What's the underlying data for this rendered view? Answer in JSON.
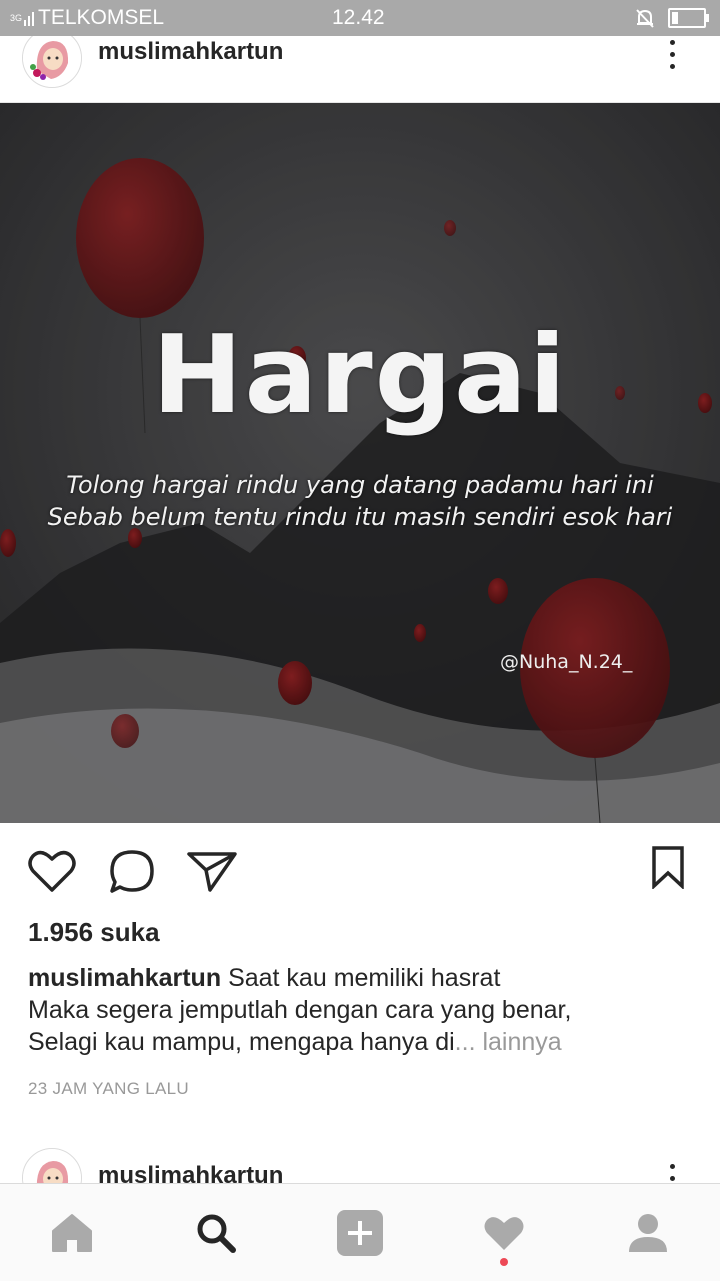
{
  "status_bar": {
    "network": "3G",
    "carrier": "TELKOMSEL",
    "time": "12.42"
  },
  "post": {
    "username": "muslimahkartun",
    "image": {
      "title": "Hargai",
      "quote_line1": "Tolong hargai rindu yang datang padamu hari ini",
      "quote_line2": "Sebab belum tentu rindu itu masih sendiri esok hari",
      "handle": "@Nuha_N.24_"
    },
    "likes": "1.956 suka",
    "caption": {
      "username": "muslimahkartun",
      "line1": "Saat kau memiliki hasrat",
      "line2": "Maka segera jemputlah dengan cara yang benar,",
      "line3": "Selagi kau mampu, mengapa hanya di",
      "more": "... lainnya"
    },
    "timestamp": "23 JAM YANG LALU"
  },
  "next_post": {
    "username": "muslimahkartun"
  },
  "icons": {
    "like": "heart-outline-icon",
    "comment": "comment-bubble-icon",
    "share": "paper-plane-icon",
    "save": "bookmark-icon",
    "more": "vertical-dots-icon"
  },
  "bottom_nav": [
    "home-icon",
    "search-icon",
    "add-post-icon",
    "activity-heart-icon",
    "profile-icon"
  ],
  "colors": {
    "status_bar": "#a9a9a9",
    "text": "#262626",
    "muted": "#999999",
    "notification": "#ed4956",
    "balloon": "#7a1a1d"
  }
}
